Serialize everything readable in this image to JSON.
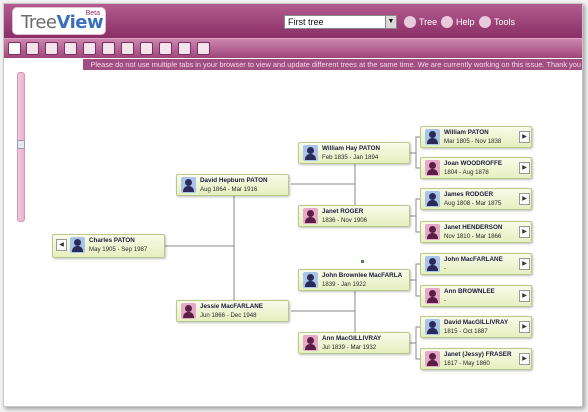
{
  "app": {
    "logo_main": "Tree",
    "logo_accent": "View",
    "logo_badge": "Beta"
  },
  "header": {
    "tree_selector_value": "First tree",
    "links": [
      {
        "label": "Tree",
        "icon": "tree-icon"
      },
      {
        "label": "Help",
        "icon": "help-icon"
      },
      {
        "label": "Tools",
        "icon": "tools-icon"
      }
    ]
  },
  "toolbar": {
    "buttons": [
      "collapse-icon",
      "people-icon",
      "family-icon",
      "add-person-icon",
      "edit-icon",
      "search-icon",
      "pen-icon",
      "calendar-icon",
      "profile-icon",
      "print-icon",
      "settings-icon"
    ]
  },
  "notice": "Please do not use multiple tabs in your browser to view and update different trees at the same time. We are currently working on this issue. Thank you",
  "people": {
    "root": {
      "name": "Charles PATON",
      "dates": "May 1905 - Sep 1987",
      "gender": "male"
    },
    "father": {
      "name": "David Hepburn PATON",
      "dates": "Aug 1864 - Mar 1916",
      "gender": "male"
    },
    "mother": {
      "name": "Jessie MacFARLANE",
      "dates": "Jun 1866 - Dec 1948",
      "gender": "female"
    },
    "pgf": {
      "name": "William Hay PATON",
      "dates": "Feb 1835 - Jan 1894",
      "gender": "male"
    },
    "pgm": {
      "name": "Janet ROGER",
      "dates": "1836 - Nov 1906",
      "gender": "female"
    },
    "mgf": {
      "name": "John Brownlee MacFARLA",
      "dates": "1839 - Jan 1922",
      "gender": "male"
    },
    "mgm": {
      "name": "Ann MacGILLIVRAY",
      "dates": "Jul 1839 - Mar 1932",
      "gender": "female"
    },
    "g1": {
      "name": "William PATON",
      "dates": "Mar 1805 - Nov 1838",
      "gender": "male"
    },
    "g2": {
      "name": "Joan WOODROFFE",
      "dates": "1804 - Aug 1878",
      "gender": "female"
    },
    "g3": {
      "name": "James RODGER",
      "dates": "Aug 1808 - Mar 1875",
      "gender": "male"
    },
    "g4": {
      "name": "Janet HENDERSON",
      "dates": "Nov 1810 - Mar 1866",
      "gender": "female"
    },
    "g5": {
      "name": "John MacFARLANE",
      "dates": "-",
      "gender": "male"
    },
    "g6": {
      "name": "Ann BROWNLEE",
      "dates": "-",
      "gender": "female"
    },
    "g7": {
      "name": "David MacGILLIVRAY",
      "dates": "1815 - Oct 1887",
      "gender": "male"
    },
    "g8": {
      "name": "Janet (Jessy) FRASER",
      "dates": "1817 - May 1860",
      "gender": "female"
    }
  },
  "nav": {
    "back": "◀",
    "forward": "▶",
    "dropdown": "▼"
  }
}
